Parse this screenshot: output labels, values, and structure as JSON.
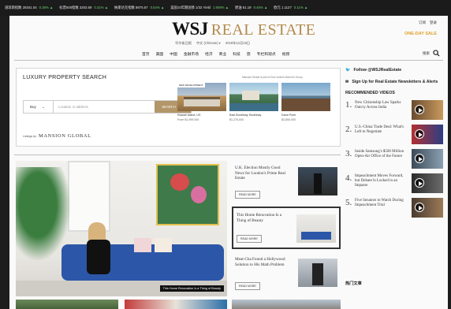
{
  "ticker": [
    {
      "name": "道琼斯指数",
      "value": "28341.04",
      "change": "0.36%",
      "arrow": "▲"
    },
    {
      "name": "标普500指数",
      "value": "3203.59",
      "change": "0.31%",
      "arrow": "▲"
    },
    {
      "name": "纳斯达克指数",
      "value": "8875.57",
      "change": "0.54%",
      "arrow": "▲"
    },
    {
      "name": "美国10年期国债",
      "value": "1/32 Yield",
      "change": "1.909%",
      "arrow": "▲"
    },
    {
      "name": "原油",
      "value": "61.19",
      "change": "0.45%",
      "arrow": "▲"
    },
    {
      "name": "欧元",
      "value": "1.1127",
      "change": "0.11%",
      "arrow": "▲"
    }
  ],
  "masthead": {
    "logo_main": "WSJ",
    "logo_sub": "REAL ESTATE",
    "edition_label": "华尔街日报",
    "language_label": "中文 (Chinese) ▾",
    "date": "2019年12月19日",
    "top_links": [
      "订阅",
      "登录"
    ],
    "promo": "ONE-DAY SALE",
    "search_label": "搜索"
  },
  "nav": [
    "首页",
    "美国",
    "中国",
    "金融市场",
    "经济",
    "商业",
    "科技",
    "旅",
    "专栏和观点",
    "视频"
  ],
  "luxury": {
    "title": "LUXURY PROPERTY SEARCH",
    "note": "Mansion Global is part of Dow Jones's Barron's Group",
    "buy_label": "Buy",
    "location_placeholder": "Location or address",
    "search_button": "SEARCH",
    "collab_label": "Listings by",
    "collab_brand": "MANSION GLOBAL",
    "listings": [
      {
        "badge": "NEW DEVELOPMENT",
        "location": "Kiawah Island, US",
        "price": "From $1,999,000"
      },
      {
        "badge": "",
        "location": "East Boothbay, Boothbay",
        "price": "$1,275,000"
      },
      {
        "badge": "",
        "location": "Dana Point",
        "price": "$3,850,000"
      }
    ]
  },
  "hero": {
    "caption": "This Home Renovation Is a Thing of Beauty"
  },
  "side_stories": [
    {
      "title": "U.K. Election Mostly Good News for London's Prime Real Estate",
      "cta": "READ MORE"
    },
    {
      "title": "This Home Renovation Is a Thing of Beauty",
      "cta": "READ MORE"
    },
    {
      "title": "Meat-Cha Found a Hollywood Solution to His Math Problem",
      "cta": "READ MORE"
    }
  ],
  "right": {
    "follow": "Follow @WSJRealEstate",
    "signup": "Sign Up for Real Estate Newsletters & Alerts",
    "videos_header": "RECOMMENDED VIDEOS",
    "videos": [
      {
        "num": "1.",
        "title": "New Citizenship Law Sparks Outcry Across India"
      },
      {
        "num": "2.",
        "title": "U.S.-China Trade Deal: What's Left to Negotiate"
      },
      {
        "num": "3.",
        "title": "Inside Samsung's $500 Million Open-Air Office of the Future"
      },
      {
        "num": "4.",
        "title": "Impeachment Moves Forward, but Debate Is Locked in an Impasse"
      },
      {
        "num": "5.",
        "title": "Five Senators to Watch During Impeachment Trial"
      }
    ],
    "hot_header": "热门文章"
  },
  "colors": {
    "accent": "#b28a4c",
    "promo": "#e0a02a",
    "ticker_up": "#6fd06f"
  }
}
